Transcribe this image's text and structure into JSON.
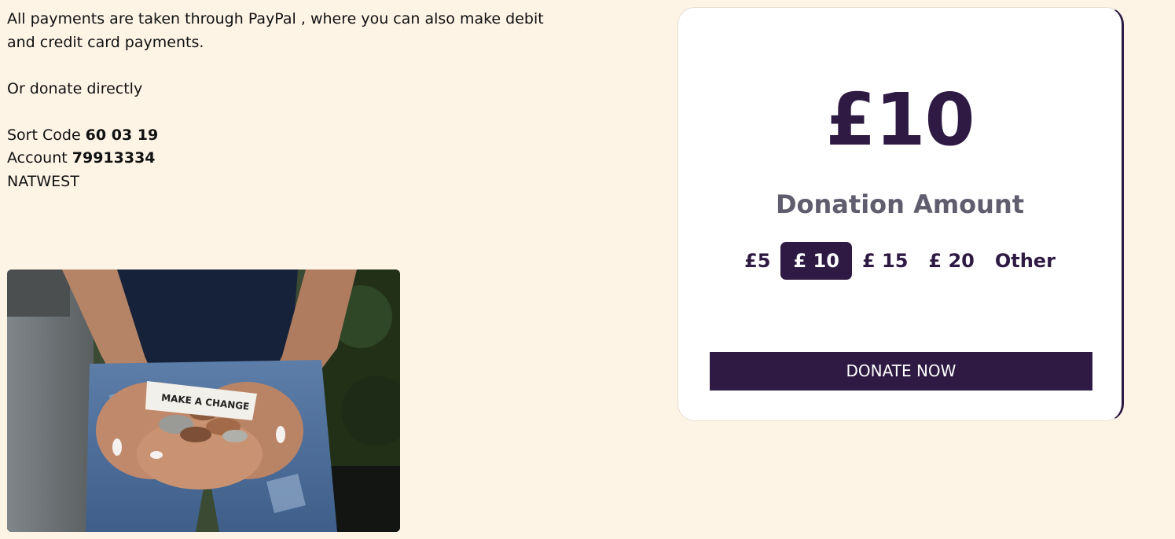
{
  "info": {
    "paypal_text_line1": "All payments are taken through PayPal , where you can also make debit",
    "paypal_text_line2": "and credit card payments.",
    "direct_text": "Or donate directly",
    "sort_code_label": "Sort Code ",
    "sort_code_value": "60 03 19",
    "account_label": "Account ",
    "account_value": "79913334",
    "bank_name": "NATWEST"
  },
  "image": {
    "note_text": "MAKE A CHANGE"
  },
  "donation": {
    "selected_amount": "£10",
    "label": "Donation Amount",
    "options": [
      {
        "label": "£5",
        "selected": false
      },
      {
        "label": "£ 10",
        "selected": true
      },
      {
        "label": "£ 15",
        "selected": false
      },
      {
        "label": "£ 20",
        "selected": false
      },
      {
        "label": "Other",
        "selected": false
      }
    ],
    "button_label": "DONATE NOW"
  },
  "colors": {
    "background": "#fdf4e6",
    "accent": "#2e1a42",
    "label_grey": "#5f5d6e",
    "card": "#ffffff"
  }
}
